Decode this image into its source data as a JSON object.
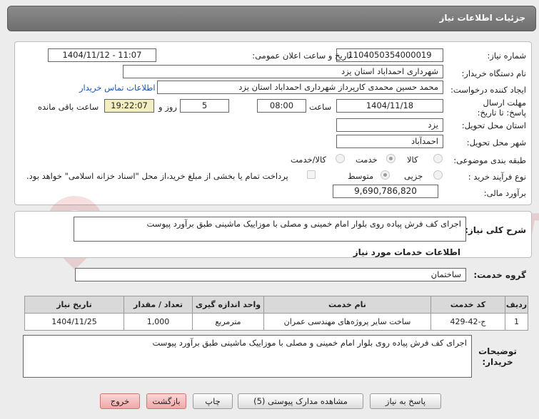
{
  "header": {
    "title": "جزئیات اطلاعات نیاز"
  },
  "fields": {
    "need_number_label": "شماره نیاز:",
    "need_number": "1104050354000019",
    "announce_label": "تاریخ و ساعت اعلان عمومی:",
    "announce_value": "1404/11/12 - 11:07",
    "buyer_org_label": "نام دستگاه خریدار:",
    "buyer_org": "شهرداری احمداباد استان یزد",
    "creator_label": "ایجاد کننده درخواست:",
    "creator": "محمد حسین محمدی کارپرداز شهرداری احمداباد استان یزد",
    "contact_link": "اطلاعات تماس خریدار",
    "deadline_label": "مهلت ارسال پاسخ: تا تاریخ:",
    "deadline_date": "1404/11/18",
    "time_label": "ساعت",
    "deadline_time": "08:00",
    "days_value": "5",
    "days_label": "روز و",
    "remaining_time": "19:22:07",
    "remaining_label": "ساعت باقی مانده",
    "province_label": "استان محل تحویل:",
    "province": "یزد",
    "city_label": "شهر محل تحویل:",
    "city": "احمدآباد",
    "category_label": "طبقه بندی موضوعی:",
    "cat_goods": "کالا",
    "cat_service": "خدمت",
    "cat_goods_service": "کالا/خدمت",
    "process_label": "نوع فرآیند خرید :",
    "proc_partial": "جزیی",
    "proc_medium": "متوسط",
    "payment_note": "پرداخت تمام یا بخشی از مبلغ خرید،از محل \"اسناد خزانه اسلامی\" خواهد بود.",
    "budget_label": "برآورد مالی:",
    "budget": "9,690,786,820"
  },
  "summary": {
    "label": "شرح کلی نیاز:",
    "text": "اجرای کف فرش پیاده روی بلوار امام خمینی و مصلی با موزاییک ماشینی طبق برآورد پیوست",
    "services_title": "اطلاعات خدمات مورد نیاز",
    "service_group_label": "گروه خدمت:",
    "service_group": "ساختمان"
  },
  "table": {
    "headers": [
      "ردیف",
      "کد خدمت",
      "نام خدمت",
      "واحد اندازه گیری",
      "تعداد / مقدار",
      "تاریخ نیاز"
    ],
    "rows": [
      [
        "1",
        "ج-42-429",
        "ساخت سایر پروژه‌های مهندسی عمران",
        "مترمربع",
        "1,000",
        "1404/11/25"
      ]
    ]
  },
  "notes": {
    "label": "توضیحات خریدار:",
    "text": "اجرای کف فرش پیاده روی بلوار امام خمینی و مصلی با موزاییک ماشینی طبق برآورد پیوست"
  },
  "buttons": {
    "reply": "پاسخ به نیاز",
    "attachments": "مشاهده مدارک پیوستی (5)",
    "print": "چاپ",
    "back": "بازگشت",
    "exit": "خروج"
  },
  "watermark": "AriaTender.neT",
  "colors": {
    "link": "#1a55b0",
    "remaining_bg": "#f3eec0",
    "header": "#7a7a7a"
  }
}
